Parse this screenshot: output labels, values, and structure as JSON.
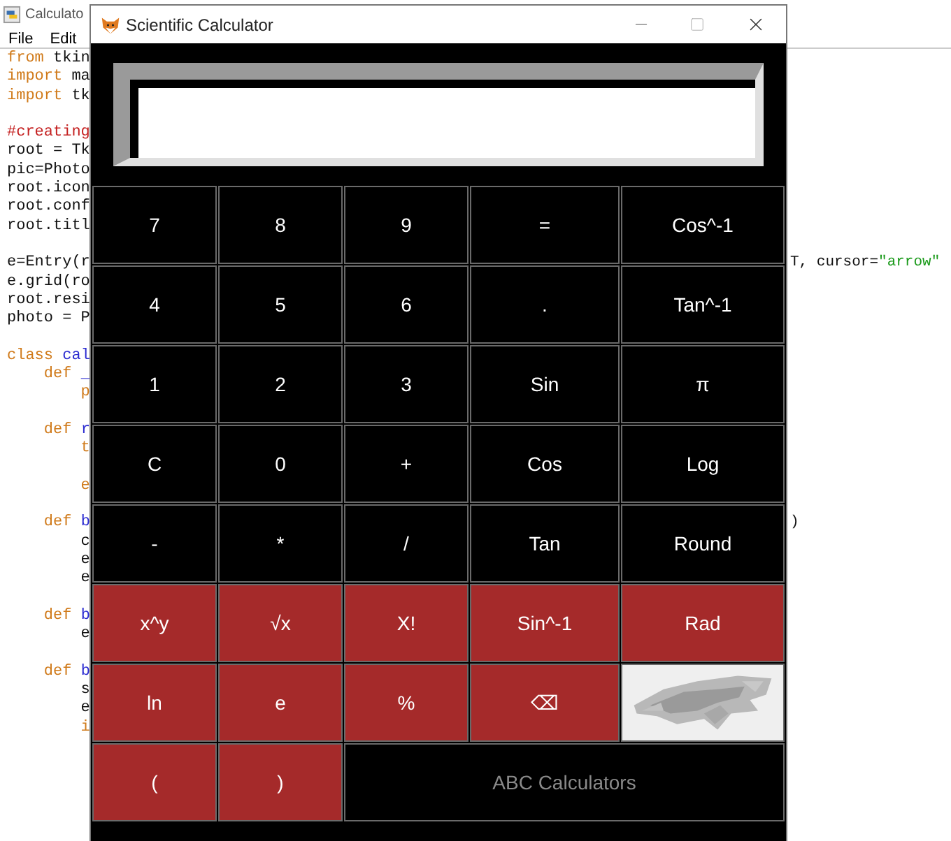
{
  "editor": {
    "title": "Calculato",
    "menu": [
      "File",
      "Edit"
    ],
    "lines": [
      {
        "parts": [
          {
            "text": "from",
            "kind": "keyword"
          },
          {
            "text": " tkin",
            "kind": "plain"
          }
        ]
      },
      {
        "parts": [
          {
            "text": "import",
            "kind": "keyword"
          },
          {
            "text": " ma",
            "kind": "plain"
          }
        ]
      },
      {
        "parts": [
          {
            "text": "import",
            "kind": "keyword"
          },
          {
            "text": " tk",
            "kind": "plain"
          }
        ]
      },
      {
        "blank_before": true,
        "parts": [
          {
            "text": "#creating",
            "kind": "comment"
          }
        ]
      },
      {
        "parts": [
          {
            "text": "root = Tk",
            "kind": "plain"
          }
        ]
      },
      {
        "parts": [
          {
            "text": "pic=Photo",
            "kind": "plain"
          }
        ]
      },
      {
        "parts": [
          {
            "text": "root.icon",
            "kind": "plain"
          }
        ]
      },
      {
        "parts": [
          {
            "text": "root.conf",
            "kind": "plain"
          }
        ]
      },
      {
        "parts": [
          {
            "text": "root.titl",
            "kind": "plain"
          }
        ]
      },
      {
        "blank_before": true,
        "parts": [
          {
            "text": "e=Entry(r",
            "kind": "plain"
          }
        ],
        "right": [
          {
            "text": "T, cursor=",
            "kind": "plain"
          },
          {
            "text": "\"arrow\"",
            "kind": "string"
          }
        ]
      },
      {
        "parts": [
          {
            "text": "e.grid(ro",
            "kind": "plain"
          }
        ]
      },
      {
        "parts": [
          {
            "text": "root.resi",
            "kind": "plain"
          }
        ]
      },
      {
        "parts": [
          {
            "text": "photo = P",
            "kind": "plain"
          }
        ]
      },
      {
        "blank_before": true,
        "parts": [
          {
            "text": "class",
            "kind": "keyword"
          },
          {
            "text": " cal",
            "kind": "name"
          }
        ]
      },
      {
        "parts": [
          {
            "text": "    def",
            "kind": "keyword"
          },
          {
            "text": " _",
            "kind": "name"
          }
        ]
      },
      {
        "parts": [
          {
            "text": "        p",
            "kind": "keyword"
          }
        ]
      },
      {
        "blank_before": true,
        "parts": [
          {
            "text": "    def",
            "kind": "keyword"
          },
          {
            "text": " r",
            "kind": "name"
          }
        ]
      },
      {
        "parts": [
          {
            "text": "        t",
            "kind": "keyword"
          }
        ]
      },
      {
        "blank_before": true,
        "parts": [
          {
            "text": "        e",
            "kind": "keyword"
          }
        ]
      },
      {
        "blank_before": true,
        "parts": [
          {
            "text": "    def",
            "kind": "keyword"
          },
          {
            "text": " b",
            "kind": "name"
          }
        ],
        "right": [
          {
            "text": ")",
            "kind": "plain"
          }
        ]
      },
      {
        "parts": [
          {
            "text": "        c",
            "kind": "plain"
          }
        ]
      },
      {
        "parts": [
          {
            "text": "        e",
            "kind": "plain"
          }
        ]
      },
      {
        "parts": [
          {
            "text": "        e",
            "kind": "plain"
          }
        ]
      },
      {
        "blank_before": true,
        "parts": [
          {
            "text": "    def",
            "kind": "keyword"
          },
          {
            "text": " b",
            "kind": "name"
          }
        ]
      },
      {
        "parts": [
          {
            "text": "        e",
            "kind": "plain"
          }
        ]
      },
      {
        "blank_before": true,
        "parts": [
          {
            "text": "    def",
            "kind": "keyword"
          },
          {
            "text": " b",
            "kind": "name"
          }
        ]
      },
      {
        "parts": [
          {
            "text": "        s",
            "kind": "plain"
          }
        ]
      },
      {
        "parts": [
          {
            "text": "        e",
            "kind": "plain"
          }
        ]
      },
      {
        "parts": [
          {
            "text": "        i",
            "kind": "keyword"
          }
        ]
      }
    ]
  },
  "window": {
    "title": "Scientific Calculator"
  },
  "buttons": [
    {
      "label": "7",
      "kind": "dark"
    },
    {
      "label": "8",
      "kind": "dark"
    },
    {
      "label": "9",
      "kind": "dark"
    },
    {
      "label": "=",
      "kind": "dark"
    },
    {
      "label": "Cos^-1",
      "kind": "dark"
    },
    {
      "label": "4",
      "kind": "dark"
    },
    {
      "label": "5",
      "kind": "dark"
    },
    {
      "label": "6",
      "kind": "dark"
    },
    {
      "label": ".",
      "kind": "dark"
    },
    {
      "label": "Tan^-1",
      "kind": "dark"
    },
    {
      "label": "1",
      "kind": "dark"
    },
    {
      "label": "2",
      "kind": "dark"
    },
    {
      "label": "3",
      "kind": "dark"
    },
    {
      "label": "Sin",
      "kind": "dark"
    },
    {
      "label": "π",
      "kind": "dark"
    },
    {
      "label": "C",
      "kind": "dark"
    },
    {
      "label": "0",
      "kind": "dark"
    },
    {
      "label": "+",
      "kind": "dark"
    },
    {
      "label": "Cos",
      "kind": "dark"
    },
    {
      "label": "Log",
      "kind": "dark"
    },
    {
      "label": "-",
      "kind": "dark"
    },
    {
      "label": "*",
      "kind": "dark"
    },
    {
      "label": "/",
      "kind": "dark"
    },
    {
      "label": "Tan",
      "kind": "dark"
    },
    {
      "label": "Round",
      "kind": "dark"
    },
    {
      "label": "x^y",
      "kind": "red"
    },
    {
      "label": "√x",
      "kind": "red"
    },
    {
      "label": "X!",
      "kind": "red"
    },
    {
      "label": "Sin^-1",
      "kind": "red"
    },
    {
      "label": "Rad",
      "kind": "red"
    },
    {
      "label": "ln",
      "kind": "red"
    },
    {
      "label": "e",
      "kind": "red"
    },
    {
      "label": "%",
      "kind": "red"
    },
    {
      "label": "⌫",
      "kind": "red"
    },
    {
      "kind": "picture"
    },
    {
      "label": "(",
      "kind": "red"
    },
    {
      "label": ")",
      "kind": "red"
    },
    {
      "label": "ABC Calculators",
      "kind": "banner"
    }
  ]
}
